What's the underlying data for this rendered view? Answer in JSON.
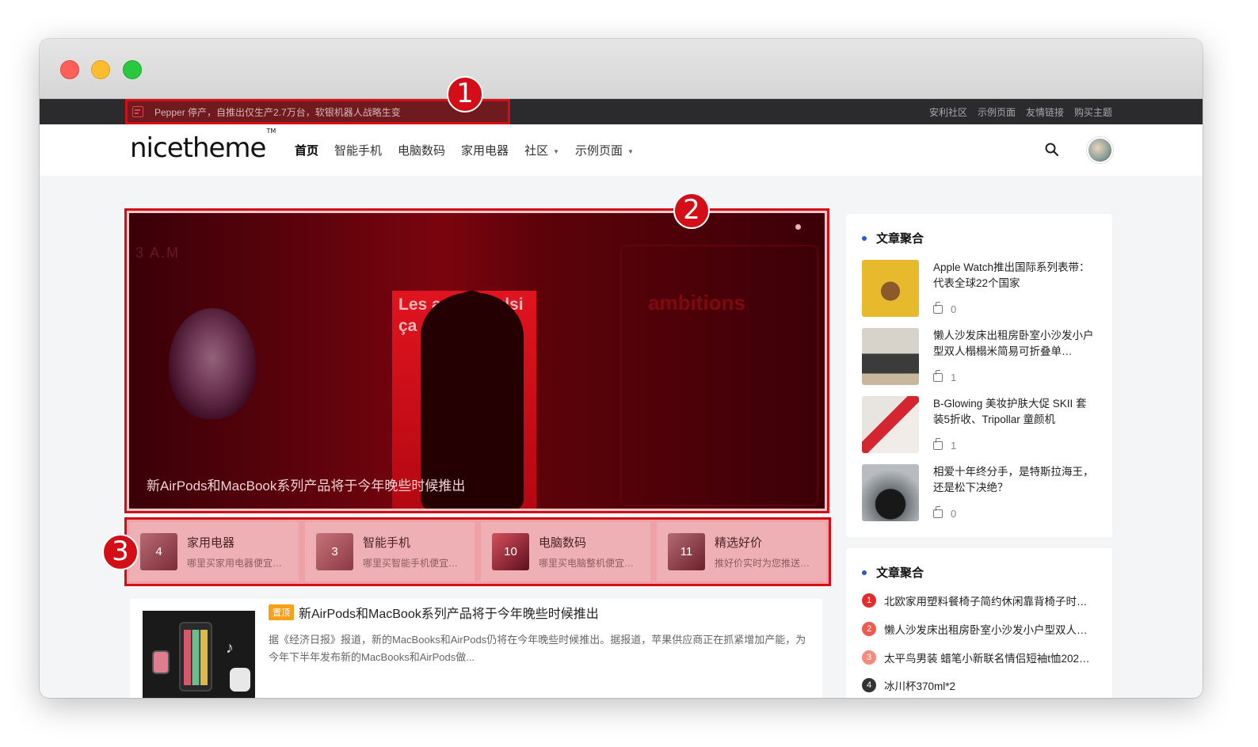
{
  "topbar": {
    "notice": "Pepper 停产，自推出仅生产2.7万台，软银机器人战略生变",
    "links": [
      "安利社区",
      "示例页面",
      "友情链接",
      "购买主题"
    ]
  },
  "header": {
    "logo": "nicetheme",
    "logo_tm": "TM",
    "nav": [
      {
        "label": "首页"
      },
      {
        "label": "智能手机"
      },
      {
        "label": "电脑数码"
      },
      {
        "label": "家用电器"
      },
      {
        "label": "社区"
      },
      {
        "label": "示例页面"
      }
    ]
  },
  "hero": {
    "caption": "新AirPods和MacBook系列产品将于今年晚些时候推出",
    "poster_text": "Les ach impulsi ça se",
    "poster_small": "ambitions",
    "corner_text": "3 A.M"
  },
  "markers": [
    "1",
    "2",
    "3"
  ],
  "categories": [
    {
      "count": "4",
      "name": "家用电器",
      "desc": "哪里买家用电器便宜…"
    },
    {
      "count": "3",
      "name": "智能手机",
      "desc": "哪里买智能手机便宜…"
    },
    {
      "count": "10",
      "name": "电脑数码",
      "desc": "哪里买电脑整机便宜…"
    },
    {
      "count": "11",
      "name": "精选好价",
      "desc": "推好价实时为您推送…"
    }
  ],
  "article": {
    "badge": "置顶",
    "title": "新AirPods和MacBook系列产品将于今年晚些时候推出",
    "excerpt": "据《经济日报》报道，新的MacBooks和AirPods仍将在今年晚些时候推出。据报道，苹果供应商正在抓紧增加产能，为今年下半年发布新的MacBooks和AirPods做..."
  },
  "sidebar": {
    "widget1_title": "文章聚合",
    "posts": [
      {
        "title": "Apple Watch推出国际系列表带：代表全球22个国家",
        "likes": "0"
      },
      {
        "title": "懒人沙发床出租房卧室小沙发小户型双人榻榻米简易可折叠单…",
        "likes": "1"
      },
      {
        "title": "B-Glowing 美妆护肤大促 SKII 套装5折收、Tripollar 童颜机",
        "likes": "1"
      },
      {
        "title": "相爱十年终分手，是特斯拉海王，还是松下决绝？",
        "likes": "0"
      }
    ],
    "widget2_title": "文章聚合",
    "ranks": [
      {
        "num": "1",
        "title": "北欧家用塑料餐椅子简约休闲靠背椅子时…",
        "color": "#e02e2e"
      },
      {
        "num": "2",
        "title": "懒人沙发床出租房卧室小沙发小户型双人…",
        "color": "#f05a4f"
      },
      {
        "num": "3",
        "title": "太平鸟男装 蜡笔小新联名情侣短袖t恤202…",
        "color": "#f58b7c"
      },
      {
        "num": "4",
        "title": "冰川杯370ml*2",
        "color": "#333333"
      }
    ]
  }
}
